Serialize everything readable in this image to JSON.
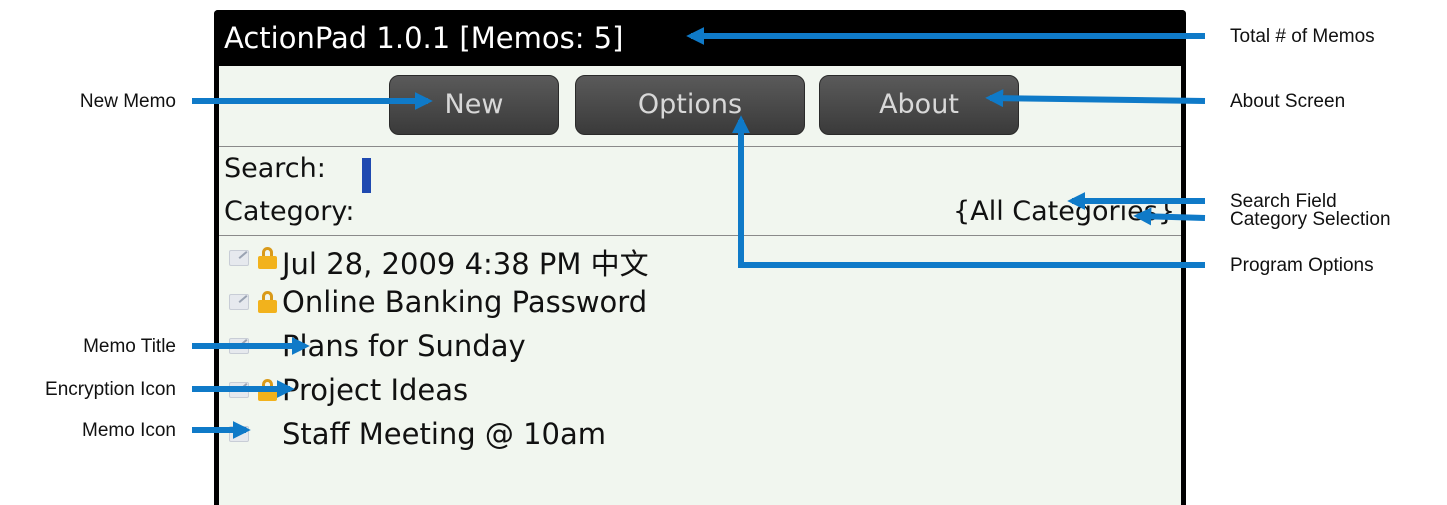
{
  "app": {
    "title": "ActionPad 1.0.1 [Memos: 5]"
  },
  "toolbar": {
    "new_label": "New",
    "options_label": "Options",
    "about_label": "About"
  },
  "search": {
    "label": "Search:",
    "value": ""
  },
  "category": {
    "label": "Category:",
    "value": "{All Categories}"
  },
  "memos": [
    {
      "title": "Jul 28, 2009 4:38 PM 中文",
      "encrypted": true,
      "icon": "memo-icon"
    },
    {
      "title": "Online Banking Password",
      "encrypted": true,
      "icon": "memo-icon"
    },
    {
      "title": "Plans for Sunday",
      "encrypted": false,
      "icon": "memo-icon"
    },
    {
      "title": "Project Ideas",
      "encrypted": true,
      "icon": "memo-icon"
    },
    {
      "title": "Staff Meeting @ 10am",
      "encrypted": false,
      "icon": "memo-icon"
    }
  ],
  "annotations": {
    "total_memos": "Total # of Memos",
    "about_screen": "About Screen",
    "search_field": "Search Field",
    "category_selection": "Category Selection",
    "program_options": "Program Options",
    "new_memo": "New Memo",
    "memo_title": "Memo Title",
    "encryption_icon": "Encryption Icon",
    "memo_icon": "Memo Icon"
  },
  "colors": {
    "arrow": "#0f7ac8",
    "cursor": "#1f49b0",
    "lock": "#f2b21c",
    "screen_bg": "#f1f6ef"
  }
}
